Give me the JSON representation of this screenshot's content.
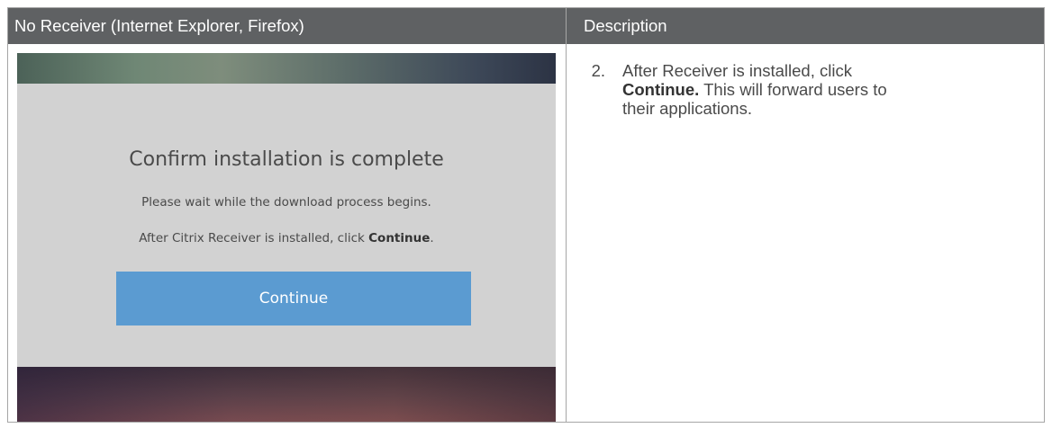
{
  "table": {
    "header_left": "No Receiver (Internet Explorer, Firefox)",
    "header_right": "Description"
  },
  "screenshot": {
    "title": "Confirm installation is complete",
    "wait_text": "Please wait while the download process begins.",
    "install_text_prefix": "After Citrix Receiver is installed, click ",
    "install_text_bold": "Continue",
    "install_text_suffix": ".",
    "continue_label": "Continue",
    "colors": {
      "dialog_bg": "#d2d2d2",
      "button_bg": "#5b9bd1",
      "header_bg": "#5f6163"
    }
  },
  "description": {
    "step_number": "2.",
    "text_prefix": "After Receiver is installed, click ",
    "text_bold": "Continue.",
    "text_suffix": " This will forward users to their applications."
  }
}
